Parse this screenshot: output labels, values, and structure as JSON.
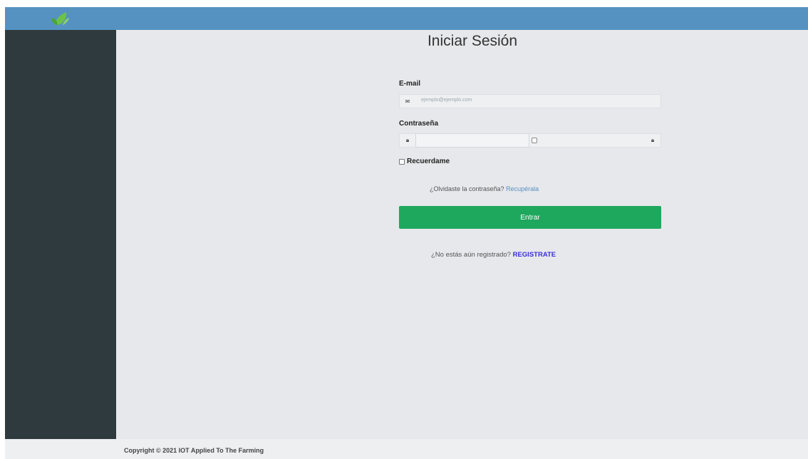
{
  "header": {
    "logo_icon": "leaf-icon"
  },
  "login": {
    "title": "Iniciar Sesión",
    "email_label": "E-mail",
    "email_icon": "envelope-icon",
    "email_placeholder": "ejemplo@ejemplo.com",
    "password_label": "Contraseña",
    "password_icon": "lock-icon",
    "remember_label": "Recuerdame",
    "forgot_text": "¿Olvidaste la contraseña?",
    "forgot_link": "Recupérala",
    "submit_label": "Entrar",
    "register_text": "¿No estás aún registrado?",
    "register_link": "REGISTRATE"
  },
  "footer": {
    "copyright": "Copyright © 2021 IOT Applied To The Farming"
  },
  "colors": {
    "topbar": "#5592c1",
    "sidebar": "#2f3a3e",
    "primary_button": "#1ea85e",
    "register_link": "#3b2fd6"
  }
}
